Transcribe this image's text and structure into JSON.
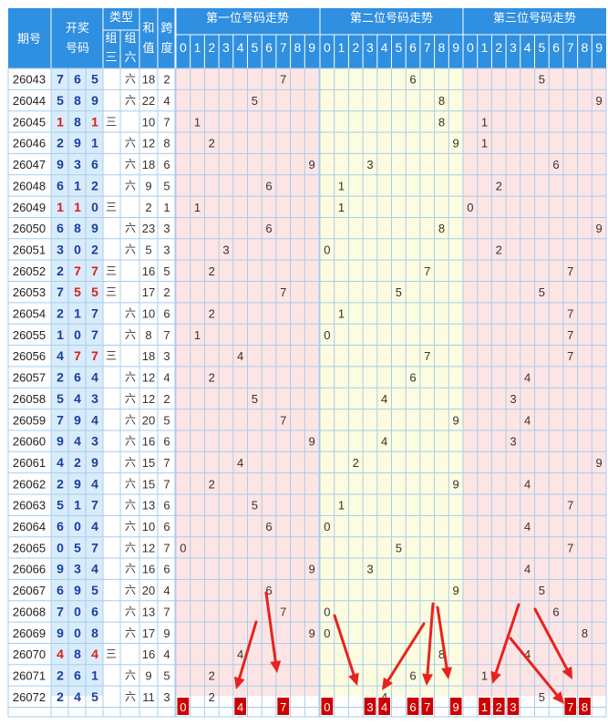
{
  "header": {
    "period_label": "期号",
    "draw_label_1": "开奖",
    "draw_label_2": "号码",
    "type_label": "类型",
    "type_group3_a": "组",
    "type_group3_b": "三",
    "type_group6_a": "组",
    "type_group6_b": "六",
    "sum_label_1": "和",
    "sum_label_2": "值",
    "span_label_1": "跨",
    "span_label_2": "度",
    "trend_titles": [
      "第一位号码走势",
      "第二位号码走势",
      "第三位号码走势"
    ],
    "digits": [
      "0",
      "1",
      "2",
      "3",
      "4",
      "5",
      "6",
      "7",
      "8",
      "9"
    ]
  },
  "colors": {
    "header_bg": "#2f8fe0",
    "grid_line": "#a9cdea",
    "trend_band_1": "#fde5e5",
    "trend_band_2": "#fcfce0",
    "trend_band_3": "#fde5e5",
    "draw_bg": "#d9ecfb",
    "draw_blue": "#1a3f9e",
    "draw_red": "#d91e1e",
    "pick_red": "#cc0000",
    "arrow_red": "#e8221d"
  },
  "chart_data": {
    "type": "table",
    "title": "",
    "group3_label": "三",
    "group6_label": "六",
    "rows": [
      {
        "period": "26043",
        "digits": [
          7,
          6,
          5
        ],
        "type": "六",
        "sum": "18",
        "span": "2"
      },
      {
        "period": "26044",
        "digits": [
          5,
          8,
          9
        ],
        "type": "六",
        "sum": "22",
        "span": "4"
      },
      {
        "period": "26045",
        "digits": [
          1,
          8,
          1
        ],
        "type": "三",
        "sum": "10",
        "span": "7"
      },
      {
        "period": "26046",
        "digits": [
          2,
          9,
          1
        ],
        "type": "六",
        "sum": "12",
        "span": "8"
      },
      {
        "period": "26047",
        "digits": [
          9,
          3,
          6
        ],
        "type": "六",
        "sum": "18",
        "span": "6"
      },
      {
        "period": "26048",
        "digits": [
          6,
          1,
          2
        ],
        "type": "六",
        "sum": "9",
        "span": "5"
      },
      {
        "period": "26049",
        "digits": [
          1,
          1,
          0
        ],
        "type": "三",
        "sum": "2",
        "span": "1"
      },
      {
        "period": "26050",
        "digits": [
          6,
          8,
          9
        ],
        "type": "六",
        "sum": "23",
        "span": "3"
      },
      {
        "period": "26051",
        "digits": [
          3,
          0,
          2
        ],
        "type": "六",
        "sum": "5",
        "span": "3"
      },
      {
        "period": "26052",
        "digits": [
          2,
          7,
          7
        ],
        "type": "三",
        "sum": "16",
        "span": "5"
      },
      {
        "period": "26053",
        "digits": [
          7,
          5,
          5
        ],
        "type": "三",
        "sum": "17",
        "span": "2"
      },
      {
        "period": "26054",
        "digits": [
          2,
          1,
          7
        ],
        "type": "六",
        "sum": "10",
        "span": "6"
      },
      {
        "period": "26055",
        "digits": [
          1,
          0,
          7
        ],
        "type": "六",
        "sum": "8",
        "span": "7"
      },
      {
        "period": "26056",
        "digits": [
          4,
          7,
          7
        ],
        "type": "三",
        "sum": "18",
        "span": "3"
      },
      {
        "period": "26057",
        "digits": [
          2,
          6,
          4
        ],
        "type": "六",
        "sum": "12",
        "span": "4"
      },
      {
        "period": "26058",
        "digits": [
          5,
          4,
          3
        ],
        "type": "六",
        "sum": "12",
        "span": "2"
      },
      {
        "period": "26059",
        "digits": [
          7,
          9,
          4
        ],
        "type": "六",
        "sum": "20",
        "span": "5"
      },
      {
        "period": "26060",
        "digits": [
          9,
          4,
          3
        ],
        "type": "六",
        "sum": "16",
        "span": "6"
      },
      {
        "period": "26061",
        "digits": [
          4,
          2,
          9
        ],
        "type": "六",
        "sum": "15",
        "span": "7"
      },
      {
        "period": "26062",
        "digits": [
          2,
          9,
          4
        ],
        "type": "六",
        "sum": "15",
        "span": "7"
      },
      {
        "period": "26063",
        "digits": [
          5,
          1,
          7
        ],
        "type": "六",
        "sum": "13",
        "span": "6"
      },
      {
        "period": "26064",
        "digits": [
          6,
          0,
          4
        ],
        "type": "六",
        "sum": "10",
        "span": "6"
      },
      {
        "period": "26065",
        "digits": [
          0,
          5,
          7
        ],
        "type": "六",
        "sum": "12",
        "span": "7"
      },
      {
        "period": "26066",
        "digits": [
          9,
          3,
          4
        ],
        "type": "六",
        "sum": "16",
        "span": "6"
      },
      {
        "period": "26067",
        "digits": [
          6,
          9,
          5
        ],
        "type": "六",
        "sum": "20",
        "span": "4"
      },
      {
        "period": "26068",
        "digits": [
          7,
          0,
          6
        ],
        "type": "六",
        "sum": "13",
        "span": "7"
      },
      {
        "period": "26069",
        "digits": [
          9,
          0,
          8
        ],
        "type": "六",
        "sum": "17",
        "span": "9"
      },
      {
        "period": "26070",
        "digits": [
          4,
          8,
          4
        ],
        "type": "三",
        "sum": "16",
        "span": "4"
      },
      {
        "period": "26071",
        "digits": [
          2,
          6,
          1
        ],
        "type": "六",
        "sum": "9",
        "span": "5"
      },
      {
        "period": "26072",
        "digits": [
          2,
          4,
          5
        ],
        "type": "六",
        "sum": "11",
        "span": "3"
      }
    ],
    "picks": [
      [
        0,
        4,
        7
      ],
      [
        0,
        3,
        4,
        6,
        7,
        9
      ],
      [
        1,
        2,
        3,
        7,
        8
      ]
    ],
    "arrows": [
      {
        "from": [
          281,
          682
        ],
        "to": [
          259,
          756
        ]
      },
      {
        "from": [
          292,
          650
        ],
        "to": [
          304,
          738
        ]
      },
      {
        "from": [
          367,
          675
        ],
        "to": [
          392,
          752
        ]
      },
      {
        "from": [
          465,
          684
        ],
        "to": [
          419,
          757
        ]
      },
      {
        "from": [
          475,
          662
        ],
        "to": [
          468,
          752
        ]
      },
      {
        "from": [
          480,
          666
        ],
        "to": [
          492,
          745
        ]
      },
      {
        "from": [
          569,
          663
        ],
        "to": [
          540,
          750
        ]
      },
      {
        "from": [
          587,
          668
        ],
        "to": [
          628,
          745
        ]
      },
      {
        "from": [
          560,
          700
        ],
        "to": [
          619,
          772
        ]
      }
    ]
  }
}
